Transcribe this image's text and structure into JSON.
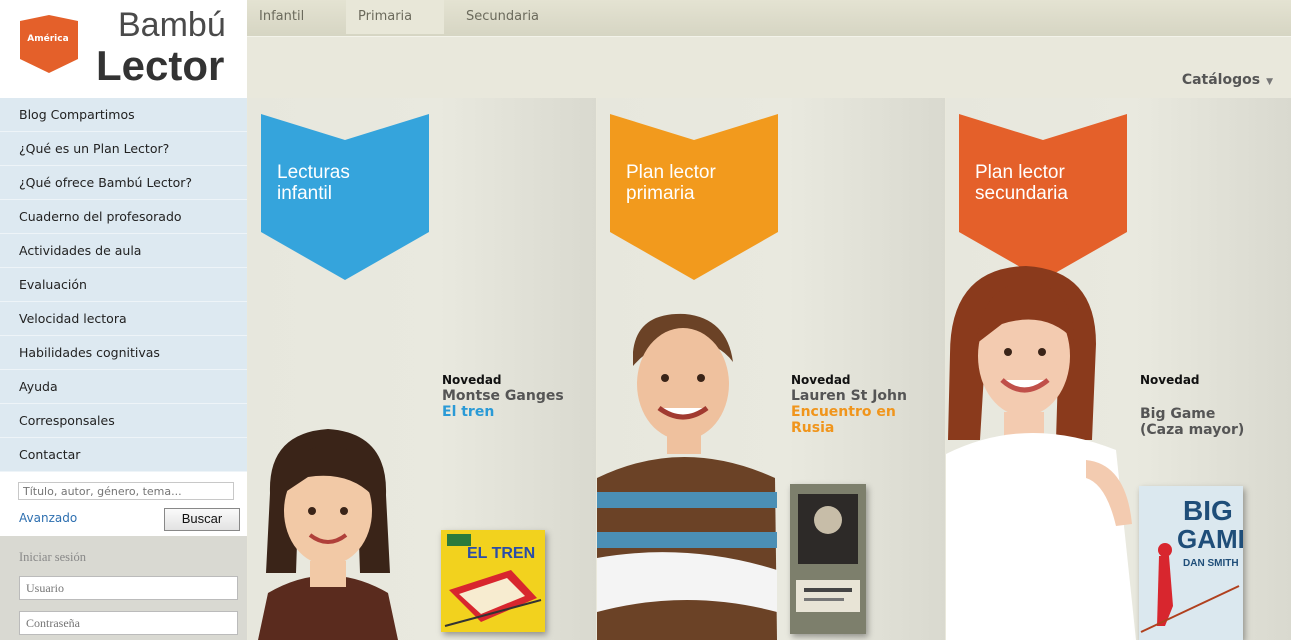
{
  "nav": {
    "tabs": [
      {
        "label": "Infantil"
      },
      {
        "label": "Primaria"
      },
      {
        "label": "Secundaria"
      }
    ]
  },
  "logo": {
    "badge": "América",
    "brand_line1": "Bambú",
    "brand_line2": "Lector"
  },
  "sidebar": {
    "items": [
      {
        "label": "Blog Compartimos"
      },
      {
        "label": "¿Qué es un Plan Lector?"
      },
      {
        "label": "¿Qué ofrece Bambú Lector?"
      },
      {
        "label": "Cuaderno del profesorado"
      },
      {
        "label": "Actividades de aula"
      },
      {
        "label": "Evaluación"
      },
      {
        "label": "Velocidad lectora"
      },
      {
        "label": "Habilidades cognitivas"
      },
      {
        "label": "Ayuda"
      },
      {
        "label": "Corresponsales"
      },
      {
        "label": "Contactar"
      }
    ]
  },
  "search": {
    "placeholder": "Título, autor, género, tema...",
    "advanced_label": "Avanzado",
    "button_label": "Buscar"
  },
  "login": {
    "title": "Iniciar sesión",
    "user_placeholder": "Usuario",
    "password_placeholder": "Contraseña"
  },
  "catalogs": {
    "label": "Catálogos"
  },
  "panels": [
    {
      "banner": "Lecturas infantil",
      "banner_line1": "Lecturas",
      "banner_line2": "infantil",
      "banner_color": "#35a4dc",
      "novedad": "Novedad",
      "author": "Montse Ganges",
      "title": "El tren",
      "title_color": "#2a9ad6",
      "cover_text": "EL TREN"
    },
    {
      "banner": "Plan lector primaria",
      "banner_line1": "Plan lector",
      "banner_line2": "primaria",
      "banner_color": "#f29a1d",
      "novedad": "Novedad",
      "author": "Lauren St John",
      "title": "Encuentro en Rusia",
      "title_line1": "Encuentro en",
      "title_line2": "Rusia",
      "title_color": "#f0951c"
    },
    {
      "banner": "Plan lector secundaria",
      "banner_line1": "Plan lector",
      "banner_line2": "secundaria",
      "banner_color": "#e4602a",
      "novedad": "Novedad",
      "author": "",
      "title": "Big Game (Caza mayor)",
      "title_line1": "Big Game",
      "title_line2": "(Caza mayor)",
      "title_color": "#555555",
      "cover_big": "BIG",
      "cover_game": "GAME",
      "cover_author": "DAN SMITH"
    }
  ]
}
